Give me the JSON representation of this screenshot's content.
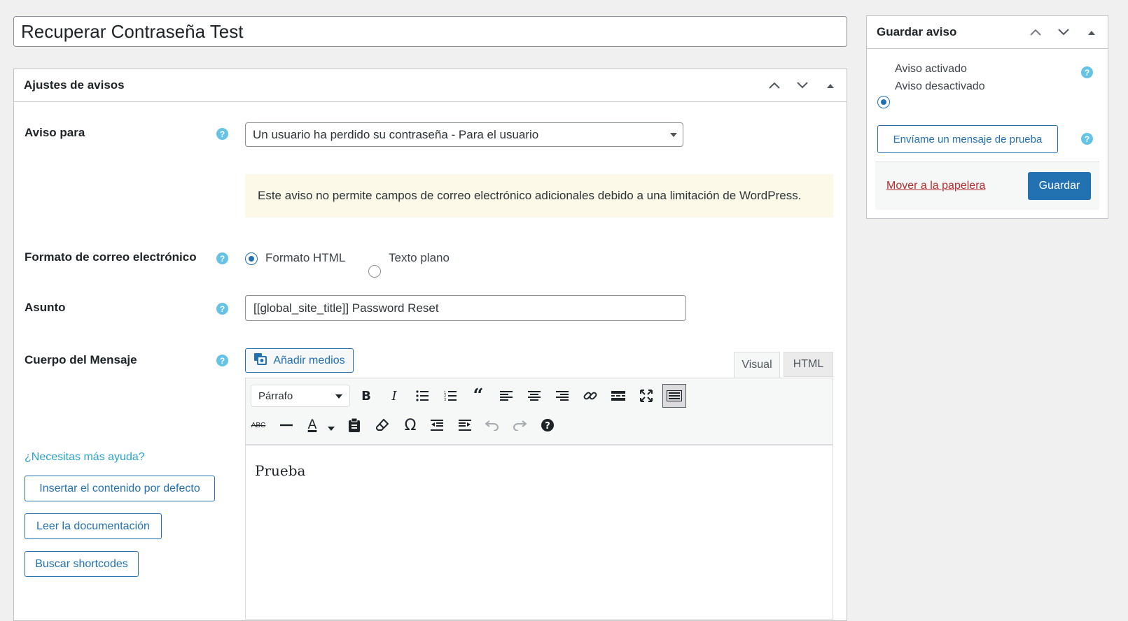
{
  "post": {
    "title": "Recuperar Contraseña Test"
  },
  "settings_box": {
    "title": "Ajustes de avisos",
    "notice_for": {
      "label": "Aviso para",
      "selected": "Un usuario ha perdido su contraseña - Para el usuario",
      "info": "Este aviso no permite campos de correo electrónico adicionales debido a una limitación de WordPress."
    },
    "email_format": {
      "label": "Formato de correo electrónico",
      "options": [
        "Formato HTML",
        "Texto plano"
      ],
      "selected": "Formato HTML"
    },
    "subject": {
      "label": "Asunto",
      "value": "[[global_site_title]] Password Reset"
    },
    "body": {
      "label": "Cuerpo del Mensaje",
      "add_media": "Añadir medios",
      "tabs": [
        "Visual",
        "HTML"
      ],
      "active_tab": "Visual",
      "format_select": "Párrafo",
      "content": "Prueba"
    },
    "help": {
      "link": "¿Necesitas más ayuda?",
      "buttons": [
        "Insertar el contenido por defecto",
        "Leer la documentación",
        "Buscar shortcodes"
      ]
    }
  },
  "save_box": {
    "title": "Guardar aviso",
    "status_options": [
      "Aviso activado",
      "Aviso desactivado"
    ],
    "status_selected": "Aviso activado",
    "test_button": "Envíame un mensaje de prueba",
    "trash_link": "Mover a la papelera",
    "save_button": "Guardar"
  },
  "colors": {
    "accent": "#2271b1",
    "help": "#67c3e6",
    "notice_bg": "#fcf9e8",
    "danger": "#b32d2e"
  }
}
